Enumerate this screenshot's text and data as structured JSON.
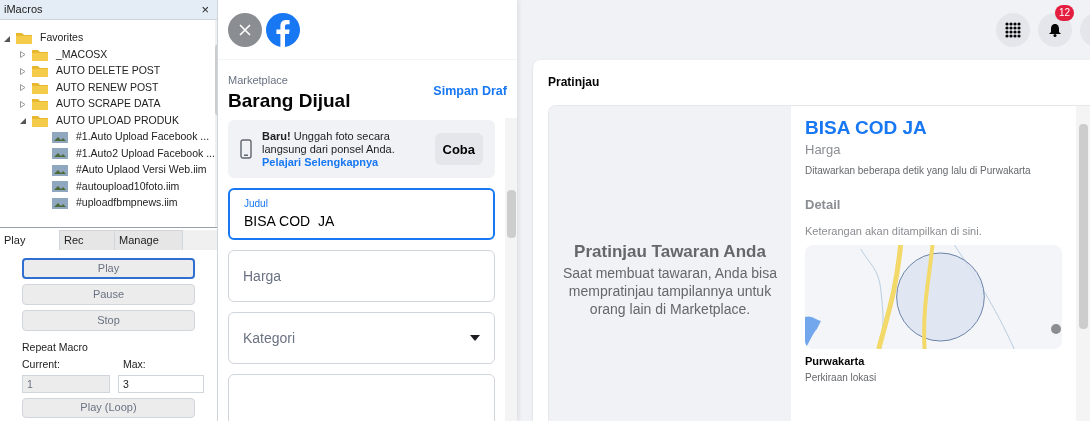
{
  "imacros": {
    "title": "iMacros",
    "close": "×",
    "tree": [
      {
        "label": "Favorites",
        "kind": "folder",
        "expanded": true,
        "children": [
          {
            "label": "_MACOSX",
            "kind": "folder",
            "expanded": false
          },
          {
            "label": "AUTO DELETE POST",
            "kind": "folder",
            "expanded": false
          },
          {
            "label": "AUTO RENEW POST",
            "kind": "folder",
            "expanded": false
          },
          {
            "label": "AUTO SCRAPE DATA",
            "kind": "folder",
            "expanded": false
          },
          {
            "label": "AUTO UPLOAD PRODUK",
            "kind": "folder",
            "expanded": true,
            "children": [
              {
                "label": "#1.Auto Upload Facebook ...",
                "kind": "macro"
              },
              {
                "label": "#1.Auto2 Upload Facebook ...",
                "kind": "macro"
              },
              {
                "label": "#Auto Uplaod Versi Web.iim",
                "kind": "macro"
              },
              {
                "label": "#autoupload10foto.iim",
                "kind": "macro"
              },
              {
                "label": "#uploadfbmpnews.iim",
                "kind": "macro"
              }
            ]
          }
        ]
      }
    ],
    "tabs": [
      {
        "label": "Play",
        "selected": true
      },
      {
        "label": "Rec",
        "selected": false
      },
      {
        "label": "Manage",
        "selected": false
      }
    ],
    "buttons": [
      {
        "label": "Play",
        "focused": true
      },
      {
        "label": "Pause",
        "focused": false
      },
      {
        "label": "Stop",
        "focused": false
      }
    ],
    "repeat": {
      "title": "Repeat Macro",
      "current_label": "Current:",
      "current_value": "1",
      "max_label": "Max:",
      "max_value": "3"
    },
    "loop_button": "Play (Loop)"
  },
  "composer": {
    "section": "Marketplace",
    "title": "Barang Dijual",
    "save_link": "Simpan Draf",
    "promo": {
      "text": "**Baru!** Unggah foto secara langsung dari ponsel Anda.",
      "link": "Pelajari Selengkapnya",
      "button": "Coba"
    },
    "fields": [
      {
        "kind": "text",
        "label": "Judul",
        "value": "BISA COD  JA",
        "focused": true
      },
      {
        "kind": "text",
        "placeholder": "Harga",
        "focused": false
      },
      {
        "kind": "select",
        "placeholder": "Kategori",
        "focused": false
      },
      {
        "kind": "blank",
        "focused": false
      }
    ]
  },
  "topbar": {
    "notification_count": "12"
  },
  "preview": {
    "heading": "Pratinjau",
    "empty_title": "Pratinjau Tawaran Anda",
    "empty_text": "Saat membuat tawaran, Anda bisa mempratinjau tampilannya untuk orang lain di Marketplace.",
    "listing_title": "BISA COD JA",
    "price": "Harga",
    "offered": "Ditawarkan beberapa detik yang lalu di Purwakarta",
    "detail_heading": "Detail",
    "detail_text": "Keterangan akan ditampilkan di sini.",
    "location": "Purwakarta",
    "location_note": "Perkiraan lokasi"
  }
}
